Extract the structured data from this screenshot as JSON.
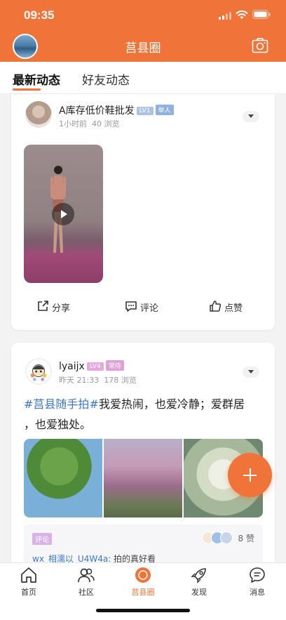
{
  "status_bar": {
    "time": "09:35"
  },
  "header": {
    "title": "莒县圈"
  },
  "tabs": [
    {
      "label": "最新动态",
      "active": true
    },
    {
      "label": "好友动态",
      "active": false
    }
  ],
  "posts": [
    {
      "username": "A库存低价鞋批发",
      "level": "LV1",
      "role": "举人",
      "time": "1小时前",
      "views": "40 浏览",
      "media": "video",
      "actions": {
        "share": "分享",
        "comment": "评论",
        "like": "点赞"
      }
    },
    {
      "username": "lyaijx",
      "level": "LV4",
      "role": "常侍",
      "time": "昨天 21:33",
      "views": "178 浏览",
      "hashtag": "#莒县随手拍#",
      "text_line1": "我爱热闹，也爱冷静；爱群居",
      "text_line2": "，也爱独处。",
      "comment_section": {
        "tag": "评论",
        "likes": "8 赞",
        "comment_user": "wx_相濡以_U4W4a:",
        "comment_text": " 拍的真好看"
      }
    }
  ],
  "bottom_nav": [
    {
      "label": "首页",
      "icon": "home-icon"
    },
    {
      "label": "社区",
      "icon": "community-icon"
    },
    {
      "label": "莒县圈",
      "icon": "circle-icon",
      "active": true
    },
    {
      "label": "发现",
      "icon": "rocket-icon"
    },
    {
      "label": "消息",
      "icon": "message-icon"
    }
  ],
  "colors": {
    "accent": "#f0743a",
    "link": "#3d77c7",
    "muted": "#999999"
  }
}
